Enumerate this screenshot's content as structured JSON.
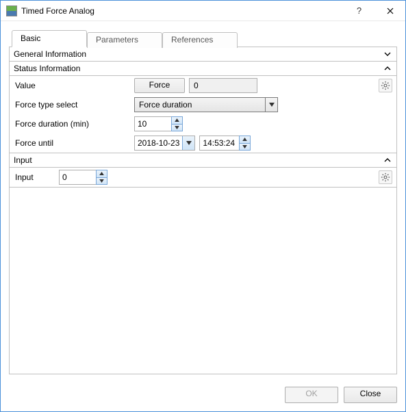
{
  "window": {
    "title": "Timed Force Analog"
  },
  "tabs": {
    "basic": "Basic",
    "parameters": "Parameters",
    "references": "References"
  },
  "sections": {
    "general": {
      "title": "General Information"
    },
    "status": {
      "title": "Status Information",
      "value_label": "Value",
      "force_button": "Force",
      "value_readonly": "0",
      "force_type_label": "Force type select",
      "force_type_selected": "Force duration",
      "force_duration_label": "Force duration (min)",
      "force_duration_value": "10",
      "force_until_label": "Force until",
      "force_until_date": "2018-10-23",
      "force_until_time": "14:53:24"
    },
    "input": {
      "title": "Input",
      "input_label": "Input",
      "input_value": "0"
    }
  },
  "footer": {
    "ok": "OK",
    "close": "Close"
  }
}
